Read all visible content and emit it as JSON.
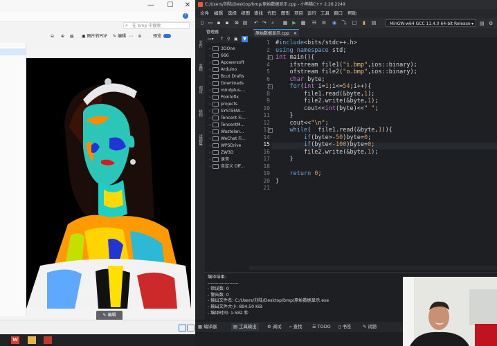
{
  "viewer": {
    "search_placeholder": "在 bmp 中搜索",
    "toolbar": {
      "to_pdf": "图片转PDF",
      "edit": "编辑",
      "preview": "预览"
    },
    "edit_button": "编辑"
  },
  "ide": {
    "title": "C:/Users/刘陆/Desktop/bmp/原始数据显示.cpp - 小熊猫C++ 2.26.2249",
    "menu": [
      "文件",
      "编辑",
      "选择",
      "视图",
      "查找",
      "代码",
      "图形",
      "项目",
      "运行",
      "工具",
      "窗口",
      "帮助"
    ],
    "compiler": "MinGW-w64 GCC 11.4.0 64-bit Release",
    "tree_header": "管理器",
    "side_tabs": [
      "文件",
      "监视",
      "调试",
      "结构",
      "试题集"
    ],
    "tree_items": [
      "3DOne",
      "666",
      "Apowersoft",
      "Arduino",
      "Bcut Drafts",
      "Downloads",
      "mindplus-…",
      "Pointofix",
      "projects",
      "SYSTEMA…",
      "Tencent Fi…",
      "TencentM…",
      "Wastelan…",
      "WeChat Fi…",
      "WPSDrive",
      "ZW3D",
      "录音",
      "自定义 Off…"
    ],
    "file_tab": "原始数据显示.cpp",
    "code_lines": [
      "#include<bits/stdc++.h>",
      "using namespace std;",
      "int main(){",
      "    ifstream file1(\"i.bmp\",ios::binary);",
      "    ofstream file2(\"o.bmp\",ios::binary);",
      "    char byte;",
      "    for(int i=1;i<=54;i++){",
      "        file1.read(&byte,1);",
      "        file2.write(&byte,1);",
      "        cout<<int(byte)<<\" \";",
      "    }",
      "    cout<<\"\\n\";",
      "    while(  file1.read(&byte,1)){",
      "        if(byte>-50)byte=0;",
      "        if(byte<-100)byte=0;",
      "        file2.write(&byte,1);",
      "    }",
      "",
      "    return 0;",
      "}",
      ""
    ],
    "line_numbers": [
      "1",
      "2",
      "3",
      "4",
      "5",
      "6",
      "7",
      "8",
      "9",
      "10",
      "11",
      "12",
      "13",
      "14",
      "15",
      "16",
      "17",
      "18",
      "19",
      "20",
      "21"
    ],
    "current_line": 15,
    "output_lines": [
      "编译结果:",
      "--------------------",
      "- 错误数: 0",
      "- 警告数: 0",
      "- 输出文件名: C:/Users/刘陆/Desktop/bmp/原始数据显示.exe",
      "- 输出文件大小: 894.50 KiB",
      "- 编译时间: 1.582 秒"
    ],
    "bottom_tabs": [
      "编译器",
      "工具输出",
      "调试",
      "查找",
      "TODO",
      "书签",
      "试题"
    ]
  },
  "colors": {
    "keyword": "#6fa8dc",
    "string": "#e6c07b",
    "type": "#c678dd",
    "number": "#d19a66",
    "accent": "#3c7ed8"
  }
}
